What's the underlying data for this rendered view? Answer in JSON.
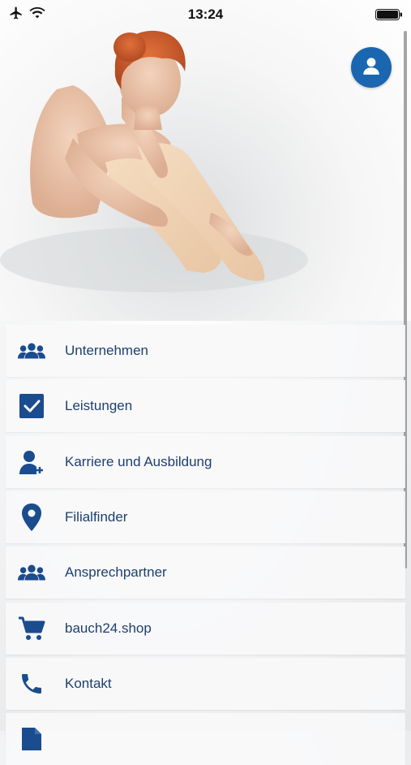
{
  "status_bar": {
    "time": "13:24"
  },
  "colors": {
    "accent": "#1a66b0",
    "icon": "#1a4c8e",
    "label": "#1d3f6e"
  },
  "profile_button": {
    "icon": "user-icon"
  },
  "menu": {
    "items": [
      {
        "label": "Unternehmen",
        "icon": "group-icon"
      },
      {
        "label": "Leistungen",
        "icon": "checkbox-icon"
      },
      {
        "label": "Karriere und Ausbildung",
        "icon": "add-user-icon"
      },
      {
        "label": "Filialfinder",
        "icon": "map-pin-icon"
      },
      {
        "label": "Ansprechpartner",
        "icon": "group-icon"
      },
      {
        "label": "bauch24.shop",
        "icon": "cart-icon"
      },
      {
        "label": "Kontakt",
        "icon": "phone-icon"
      },
      {
        "label": "",
        "icon": "document-icon"
      }
    ]
  }
}
